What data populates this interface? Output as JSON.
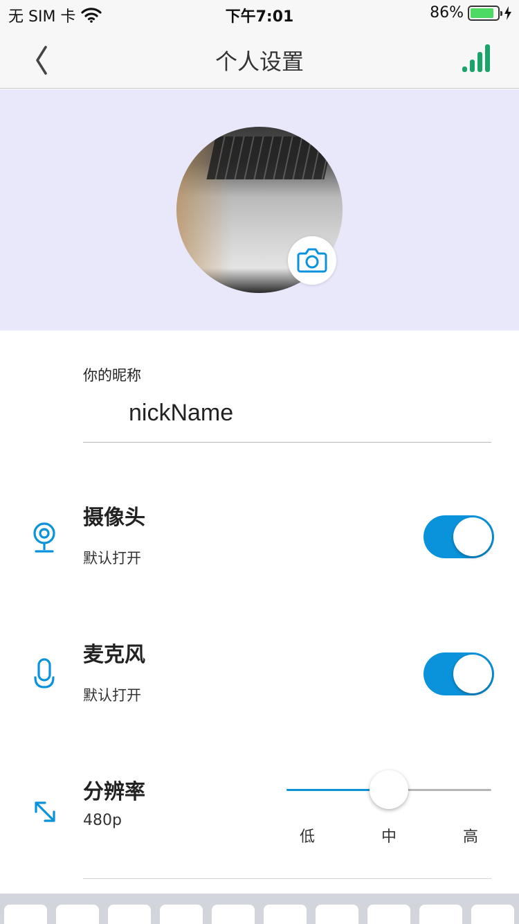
{
  "status_bar": {
    "carrier": "无 SIM 卡",
    "time": "下午7:01",
    "battery_percent": "86%",
    "battery_level": 0.86,
    "wifi_icon": "wifi-icon",
    "charging_icon": "bolt-icon"
  },
  "nav": {
    "title": "个人设置",
    "back_icon": "chevron-left-icon",
    "right_icon": "signal-bars-icon"
  },
  "profile": {
    "avatar_band_color": "#e9e8fb",
    "camera_icon": "camera-icon"
  },
  "nickname": {
    "label": "你的昵称",
    "value": "nickName"
  },
  "camera_setting": {
    "title": "摄像头",
    "subtitle": "默认打开",
    "enabled": true,
    "icon": "webcam-icon"
  },
  "mic_setting": {
    "title": "麦克风",
    "subtitle": "默认打开",
    "enabled": true,
    "icon": "microphone-icon"
  },
  "resolution_setting": {
    "title": "分辨率",
    "subtitle": "480p",
    "icon": "expand-arrows-icon",
    "level": 0.5,
    "levels": [
      "低",
      "中",
      "高"
    ]
  },
  "colors": {
    "accent": "#0a93db",
    "signal_green": "#1aa36b",
    "battery_green": "#4cd964"
  }
}
